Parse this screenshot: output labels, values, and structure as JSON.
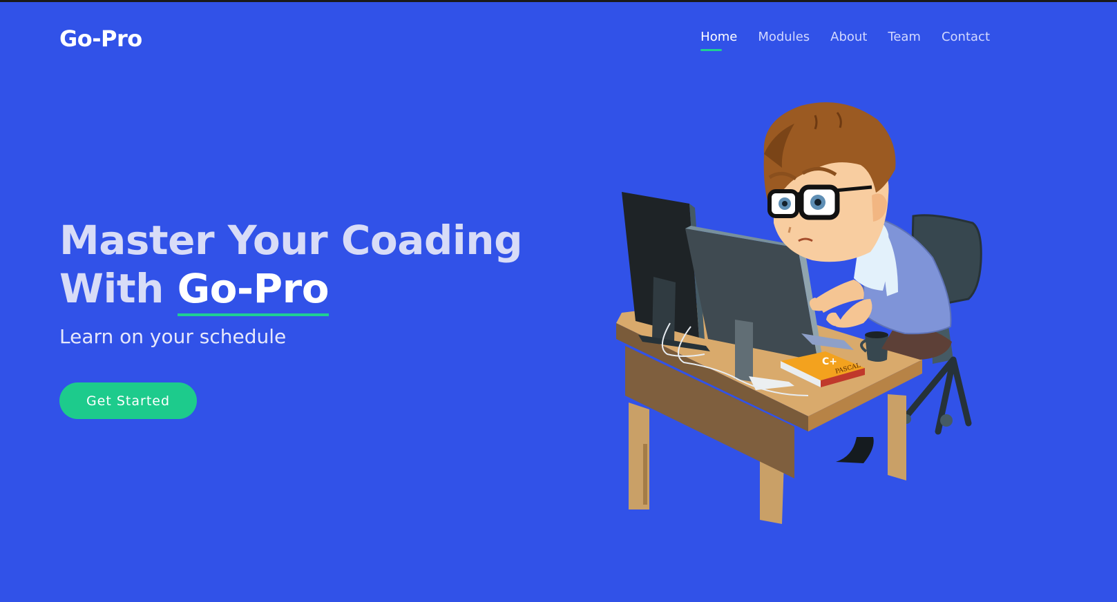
{
  "header": {
    "logo": "Go-Pro",
    "nav": [
      {
        "label": "Home",
        "active": true
      },
      {
        "label": "Modules",
        "active": false
      },
      {
        "label": "About",
        "active": false
      },
      {
        "label": "Team",
        "active": false
      },
      {
        "label": "Contact",
        "active": false
      }
    ]
  },
  "hero": {
    "title_line1": "Master Your Coading",
    "title_line2_prefix": "With ",
    "title_brand": "Go-Pro",
    "subtitle": "Learn on your schedule",
    "cta_label": "Get Started",
    "book_spine_label": "PASCAL",
    "book_cover_label": "C+"
  },
  "colors": {
    "background": "#3152e8",
    "accent": "#1fcf93",
    "button": "#1dcb8c"
  },
  "icons": {
    "illustration": "developer-at-desk-illustration"
  }
}
